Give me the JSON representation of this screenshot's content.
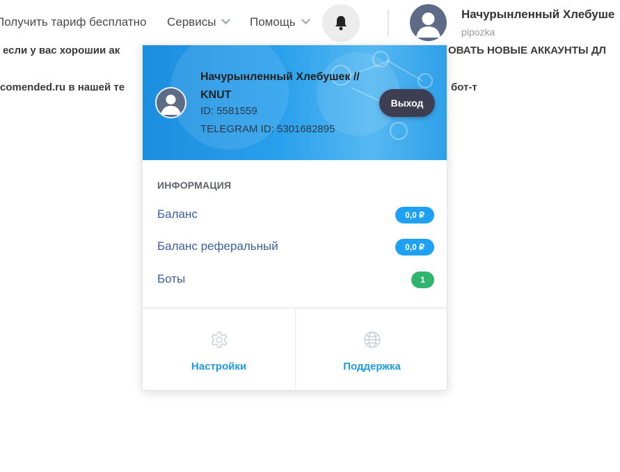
{
  "nav": {
    "free_plan": "Получить тариф бесплатно",
    "services": "Сервисы",
    "help": "Помощь"
  },
  "user": {
    "name": "Начурынленный Хлебуше",
    "login": "pipozka"
  },
  "background": {
    "line1_left": "если у вас хорошии ак",
    "line1_right": "ОВАТЬ НОВЫЕ АККАУНТЫ ДЛ",
    "line2_left": "comended.ru в нашей те",
    "line2_right": "бот-т"
  },
  "dropdown": {
    "name": "Начурынленный Хлебушек // KNUT",
    "id_line": "ID: 5581559",
    "telegram_line": "TELEGRAM ID: 5301682895",
    "logout": "Выход",
    "info_title": "ИНФОРМАЦИЯ",
    "rows": [
      {
        "label": "Баланс",
        "value": "0,0 ₽"
      },
      {
        "label": "Баланс реферальный",
        "value": "0,0 ₽"
      },
      {
        "label": "Боты",
        "value": "1"
      }
    ],
    "settings": "Настройки",
    "support": "Поддержка"
  },
  "colors": {
    "accent": "#1ea1f2",
    "badge_green": "#2fb56e",
    "logout_bg": "#3d3e52",
    "link": "#3b5fa0"
  },
  "icons": [
    "chevron-down-icon",
    "bell-icon",
    "avatar-icon",
    "gear-icon",
    "globe-icon"
  ]
}
